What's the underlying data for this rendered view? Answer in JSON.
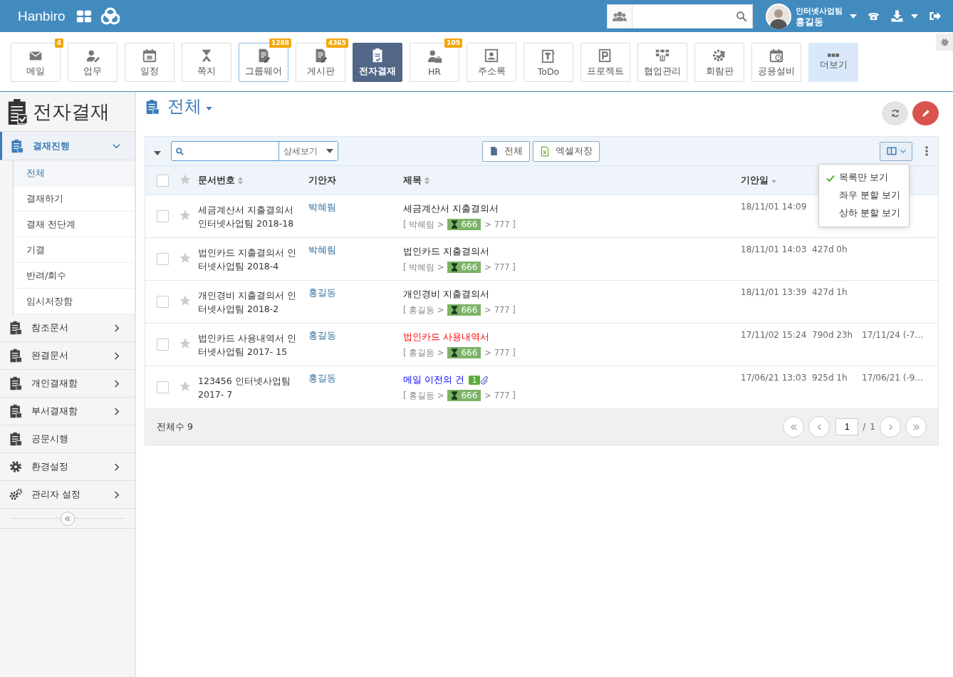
{
  "topbar": {
    "logo": "Hanbiro",
    "user": {
      "team": "인터넷사업팀",
      "name": "홍길동"
    }
  },
  "nav": [
    {
      "label": "메일",
      "badge": "4",
      "selected": false,
      "focused": false,
      "kind": "app"
    },
    {
      "label": "업무",
      "selected": false,
      "focused": false,
      "kind": "app"
    },
    {
      "label": "일정",
      "selected": false,
      "focused": false,
      "kind": "app"
    },
    {
      "label": "쪽지",
      "selected": false,
      "focused": false,
      "kind": "app"
    },
    {
      "label": "그룹웨어",
      "badge": "1288",
      "selected": false,
      "focused": true,
      "kind": "app"
    },
    {
      "label": "게시판",
      "badge": "4365",
      "selected": false,
      "focused": false,
      "kind": "app"
    },
    {
      "label": "전자결재",
      "selected": true,
      "focused": false,
      "kind": "app"
    },
    {
      "label": "HR",
      "badge": "105",
      "selected": false,
      "focused": false,
      "kind": "app"
    },
    {
      "label": "주소록",
      "selected": false,
      "focused": false,
      "kind": "app"
    },
    {
      "label": "ToDo",
      "selected": false,
      "focused": false,
      "kind": "app"
    },
    {
      "label": "프로젝트",
      "selected": false,
      "focused": false,
      "kind": "app"
    },
    {
      "label": "협업관리",
      "selected": false,
      "focused": false,
      "kind": "app"
    },
    {
      "label": "회람판",
      "selected": false,
      "focused": false,
      "kind": "app"
    },
    {
      "label": "공용설비",
      "selected": false,
      "focused": false,
      "kind": "app"
    },
    {
      "label": "더보기",
      "selected": false,
      "focused": false,
      "kind": "more"
    }
  ],
  "sidebar": {
    "title": "전자결재",
    "items": [
      {
        "label": "결재진행",
        "kind": "folder",
        "expanded": true,
        "children": [
          {
            "label": "전체",
            "selected": true
          },
          {
            "label": "결재하기",
            "selected": false
          },
          {
            "label": "결재 전단계",
            "selected": false
          },
          {
            "label": "기결",
            "selected": false
          },
          {
            "label": "반려/회수",
            "selected": false
          },
          {
            "label": "임시저장함",
            "selected": false
          }
        ]
      },
      {
        "label": "참조문서",
        "kind": "folder",
        "expanded": false
      },
      {
        "label": "완결문서",
        "kind": "folder",
        "expanded": false
      },
      {
        "label": "개인결재함",
        "kind": "folder",
        "expanded": false
      },
      {
        "label": "부서결재함",
        "kind": "folder",
        "expanded": false
      },
      {
        "label": "공문시행",
        "kind": "leaf",
        "expanded": false
      },
      {
        "label": "환경설정",
        "kind": "folder",
        "expanded": false
      },
      {
        "label": "관리자 설정",
        "kind": "folder",
        "expanded": false
      }
    ]
  },
  "page": {
    "title": "전체"
  },
  "toolbar": {
    "filter": "상세보기",
    "buttons": [
      "전체",
      "엑셀저장"
    ]
  },
  "view_menu": [
    {
      "label": "목록만 보기",
      "selected": true
    },
    {
      "label": "좌우 분할 보기",
      "selected": false
    },
    {
      "label": "상하 분할 보기",
      "selected": false
    }
  ],
  "table": {
    "all_checked": false,
    "columns": [
      "문서번호",
      "기안자",
      "제목",
      "기안일"
    ],
    "rows": [
      {
        "doc_no": "세금계산서 지출결의서 인터넷사업팀 2018-18",
        "drafter": "박혜림",
        "title": "세금계산서 지출결의서",
        "kind": "normal",
        "line": {
          "before": "[ 박혜림 >",
          "current": "666",
          "after": "> 777 ]"
        },
        "date": "18/11/01 14:09",
        "checked": false,
        "starred": false
      },
      {
        "doc_no": "법인카드 지출결의서 인터넷사업팀 2018-4",
        "drafter": "박혜림",
        "title": "법인카드 지출결의서",
        "kind": "normal",
        "line": {
          "before": "[ 박혜림 >",
          "current": "666",
          "after": "> 777 ]"
        },
        "date": "18/11/01 14:03",
        "column_5": "427d 0h",
        "checked": false,
        "starred": false
      },
      {
        "doc_no": "개인경비 지출결의서 인터넷사업팀 2018-2",
        "drafter": "홍길동",
        "title": "개인경비 지출결의서",
        "kind": "normal",
        "line": {
          "before": "[ 홍길동 >",
          "current": "666",
          "after": "> 777 ]"
        },
        "date": "18/11/01 13:39",
        "column_5": "427d 1h",
        "checked": false,
        "starred": false
      },
      {
        "doc_no": "법인카드 사용내역서 인터넷사업팀 2017- 15",
        "drafter": "홍길동",
        "title": "법인카드 사용내역서",
        "kind": "urgent",
        "line": {
          "before": "[ 홍길동 >",
          "current": "666",
          "after": "> 777 ]"
        },
        "date": "17/11/02 15:24",
        "column_5": "790d 23h",
        "column_6": "17/11/24 (-7...",
        "checked": false,
        "starred": false
      },
      {
        "doc_no": "123456 인터넷사업팀 2017- 7",
        "drafter": "홍길동",
        "title": "메일 이전의 건",
        "kind": "mail",
        "comments": "1",
        "attachment": true,
        "line": {
          "before": "[ 홍길동 >",
          "current": "666",
          "after": "> 777 ]"
        },
        "date": "17/06/21 13:03",
        "column_5": "925d 1h",
        "column_6": "17/06/21 (-9...",
        "checked": false,
        "starred": false
      }
    ]
  },
  "footer": {
    "total": "전체수 9",
    "page": "1",
    "separator": "/",
    "pages": "1"
  }
}
